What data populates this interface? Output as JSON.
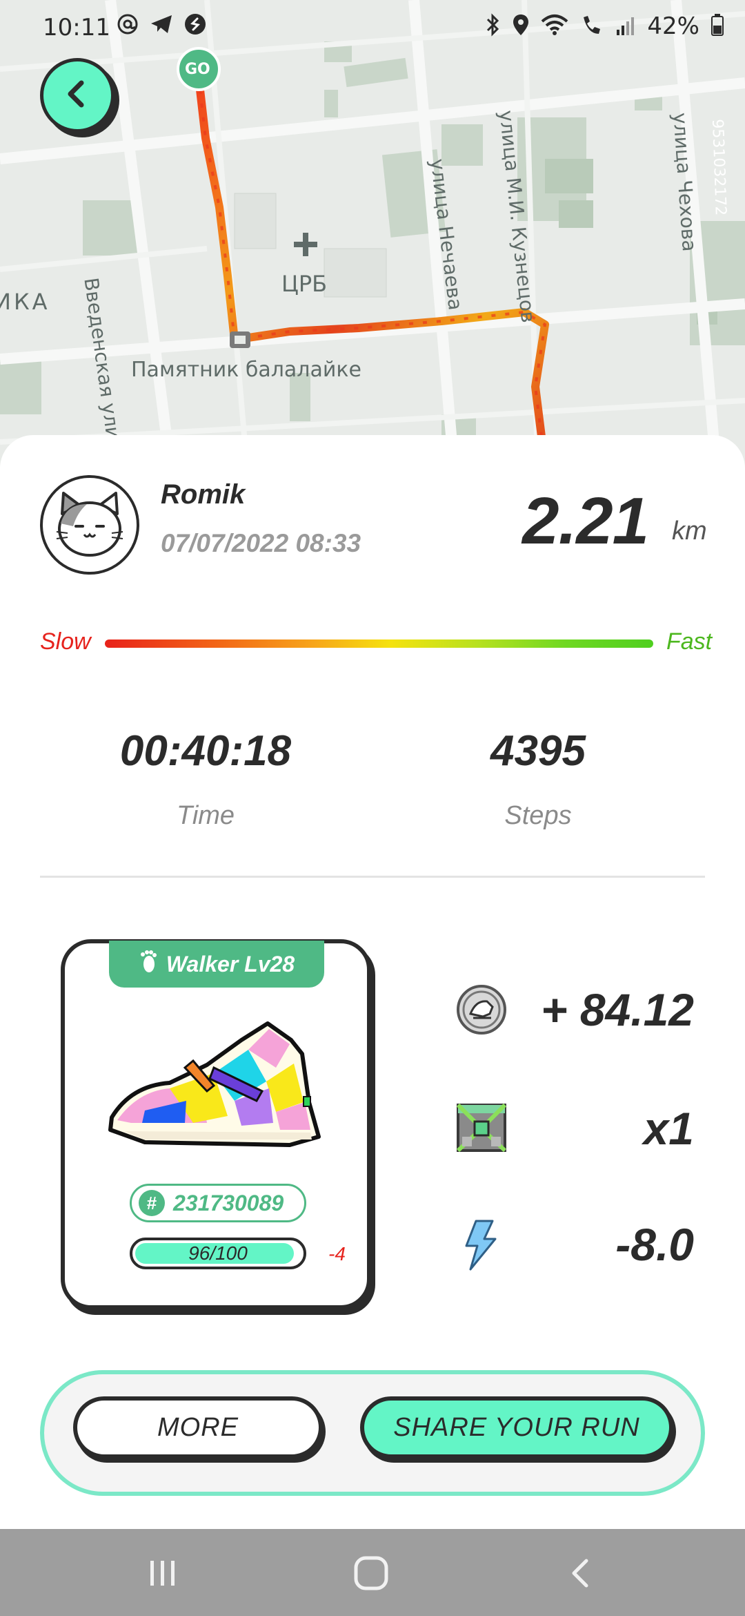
{
  "status_bar": {
    "time": "10:11",
    "battery": "42%",
    "left_icons": [
      "at-icon",
      "telegram-icon",
      "shazam-icon"
    ],
    "right_icons": [
      "bluetooth-icon",
      "location-icon",
      "wifi-icon",
      "volte-call-icon",
      "signal-icon",
      "battery-icon"
    ]
  },
  "map": {
    "start_marker": "GO",
    "labels": {
      "hospital": "ЦРБ",
      "monument": "Памятник балалайке",
      "street_vvedenskaya": "Введенская ули",
      "street_nechaeva": "улица Нечаева",
      "street_kuznetsova": "улица М.И. Кузнецов",
      "street_chekhova": "улица Чехова",
      "phone_number": "9531032172",
      "cut_label": "ИКА"
    }
  },
  "header": {
    "back_icon": "chevron-left-icon"
  },
  "run": {
    "user_name": "Romik",
    "date": "07/07/2022 08:33",
    "distance": "2.21",
    "distance_unit": "km",
    "speed_legend": {
      "slow": "Slow",
      "fast": "Fast"
    },
    "time_value": "00:40:18",
    "time_label": "Time",
    "steps_value": "4395",
    "steps_label": "Steps"
  },
  "sneaker": {
    "level_label": "Walker Lv28",
    "id": "231730089",
    "durability_text": "96/100",
    "durability_fraction": 0.96,
    "durability_delta": "-4"
  },
  "rewards": [
    {
      "icon": "gst-coin-icon",
      "value": "+ 84.12"
    },
    {
      "icon": "mystery-box-icon",
      "value": "x1"
    },
    {
      "icon": "energy-bolt-icon",
      "value": "-8.0"
    }
  ],
  "actions": {
    "more_label": "MORE",
    "share_label": "SHARE YOUR RUN"
  },
  "colors": {
    "accent_mint": "#63f5c6",
    "accent_green": "#4fb985",
    "slow_red": "#e6221c",
    "fast_green": "#4cb71e"
  }
}
